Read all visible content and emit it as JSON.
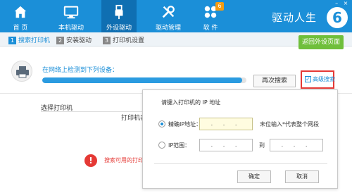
{
  "nav": {
    "items": [
      {
        "label": "首 页",
        "icon": "home-icon"
      },
      {
        "label": "本机驱动",
        "icon": "monitor-icon"
      },
      {
        "label": "外设驱动",
        "icon": "usb-icon"
      },
      {
        "label": "驱动管理",
        "icon": "wrench-icon"
      },
      {
        "label": "软 件",
        "icon": "apps-icon",
        "badge": "6"
      }
    ],
    "brand": "驱动人生",
    "brand_logo": "6",
    "window_controls": [
      "–",
      "×"
    ]
  },
  "steps": [
    {
      "num": "1",
      "label": "搜索打印机"
    },
    {
      "num": "2",
      "label": "安装驱动"
    },
    {
      "num": "3",
      "label": "打印机设置"
    }
  ],
  "back_button": "返回外设页面",
  "main": {
    "detect_label": "在网络上检测到下列设备：",
    "progress": 0.98,
    "rescan_button": "再次搜索",
    "advanced_search": "高级搜索",
    "select_printer": "选择打印机",
    "printer_name_col": "打印机名",
    "error_text": "搜索可用的打印机"
  },
  "dialog": {
    "title": "请键入打印机的 IP 地址",
    "exact_ip_label": "精确IP地址：",
    "exact_ip_value": ". . .",
    "hint": "末位输入*代表整个网段",
    "range_label": "IP范围：",
    "range_from": ". . .",
    "to_label": "到",
    "range_to": ". . .",
    "confirm": "确定",
    "cancel": "取消"
  },
  "colors": {
    "primary": "#1b8fd8",
    "active_tab": "#0f6fb2",
    "back_button": "#6fbf3b",
    "error": "#e53935",
    "highlight_box": "#e53935"
  }
}
